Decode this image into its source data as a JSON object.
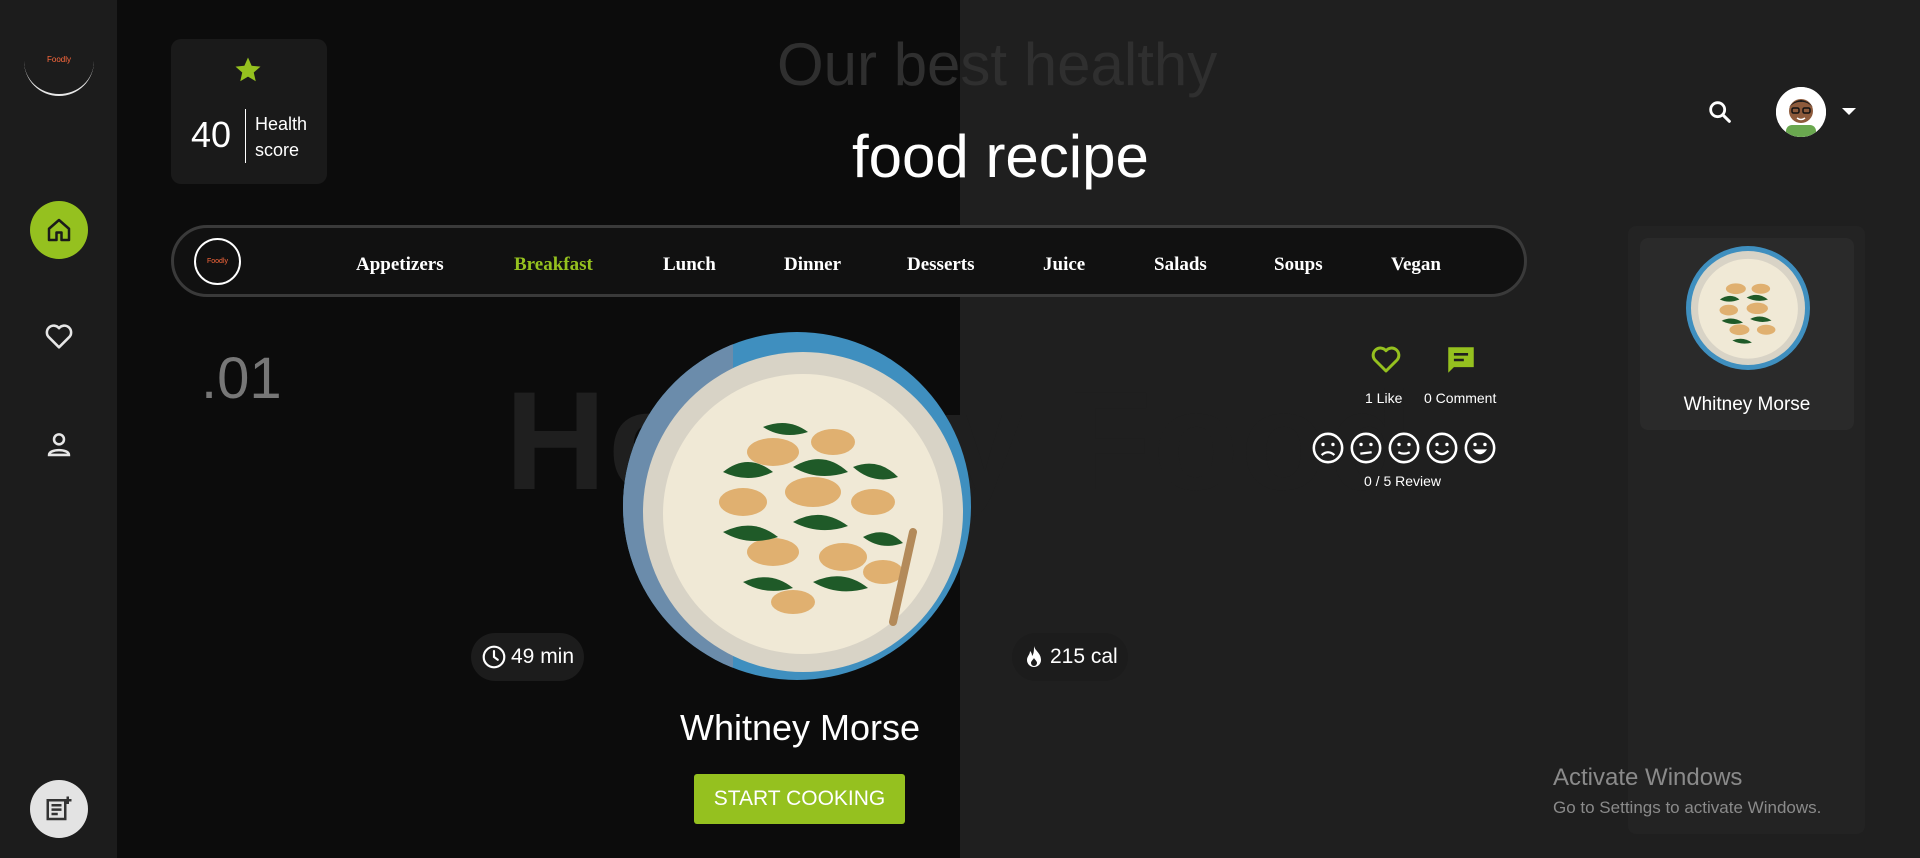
{
  "brand": {
    "logo_text": "Foodly"
  },
  "health": {
    "score": "40",
    "label": "Health score"
  },
  "header": {
    "bg_title": "Our best healthy",
    "title": "food recipe"
  },
  "categories": [
    {
      "label": "Appetizers",
      "active": false
    },
    {
      "label": "Breakfast",
      "active": true
    },
    {
      "label": "Lunch",
      "active": false
    },
    {
      "label": "Dinner",
      "active": false
    },
    {
      "label": "Desserts",
      "active": false
    },
    {
      "label": "Juice",
      "active": false
    },
    {
      "label": "Salads",
      "active": false
    },
    {
      "label": "Soups",
      "active": false
    },
    {
      "label": "Vegan",
      "active": false
    }
  ],
  "hero": {
    "index": ".01",
    "background_text": "Healthy Food",
    "time": "49 min",
    "calories": "215 cal",
    "name": "Whitney Morse",
    "cta": "START COOKING"
  },
  "actions": {
    "likes": "1 Like",
    "comments": "0 Comment",
    "review": "0 / 5 Review"
  },
  "sidebar_right": {
    "name": "Whitney Morse"
  },
  "watermark": {
    "title": "Activate Windows",
    "subtitle": "Go to Settings to activate Windows."
  },
  "colors": {
    "accent": "#95c11f",
    "background": "#1f1f1f",
    "panel": "#0c0c0c"
  }
}
